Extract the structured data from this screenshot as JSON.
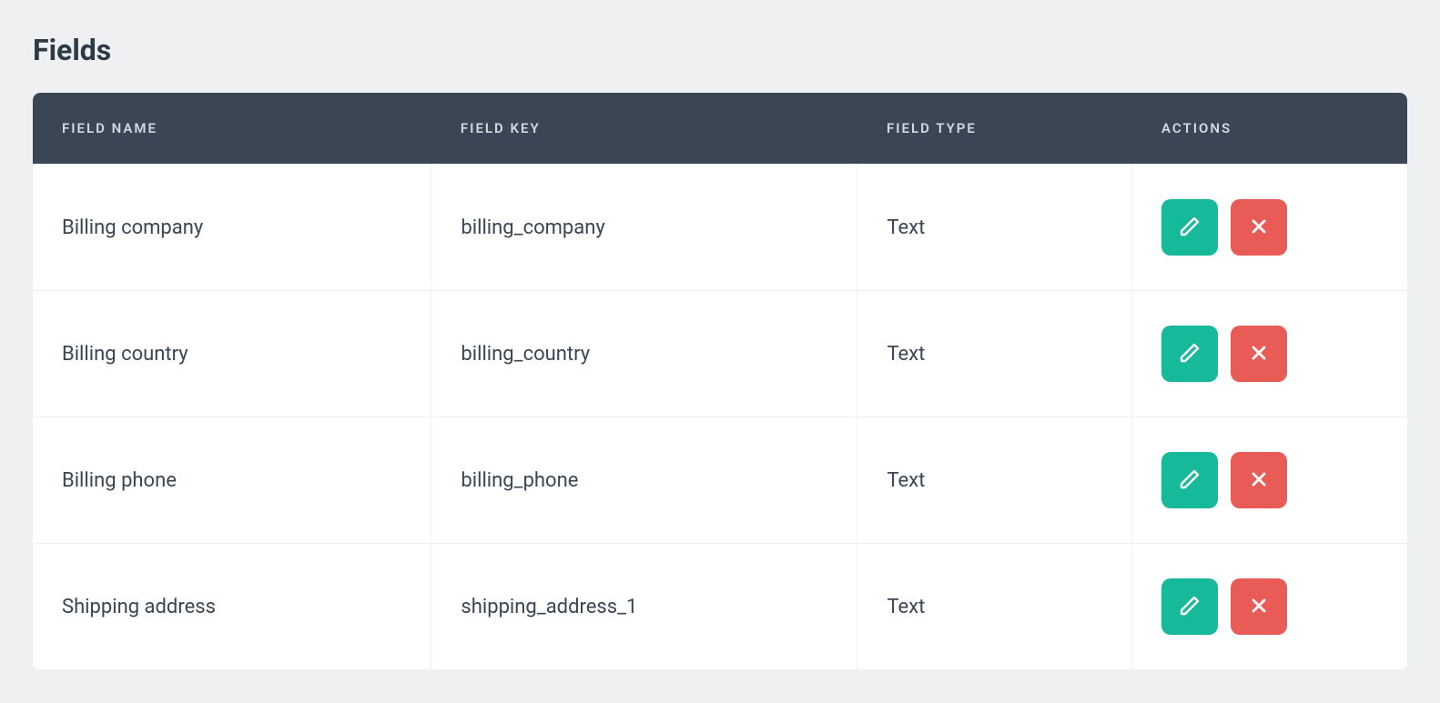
{
  "title": "Fields",
  "columns": {
    "name": "FIELD NAME",
    "key": "FIELD KEY",
    "type": "FIELD TYPE",
    "actions": "ACTIONS"
  },
  "rows": [
    {
      "name": "Billing company",
      "key": "billing_company",
      "type": "Text"
    },
    {
      "name": "Billing country",
      "key": "billing_country",
      "type": "Text"
    },
    {
      "name": "Billing phone",
      "key": "billing_phone",
      "type": "Text"
    },
    {
      "name": "Shipping address",
      "key": "shipping_address_1",
      "type": "Text"
    }
  ],
  "icons": {
    "edit": "pencil-icon",
    "delete": "close-icon"
  },
  "colors": {
    "header_bg": "#3a4653",
    "page_bg": "#eef0f2",
    "edit_bg": "#16b99a",
    "delete_bg": "#e95b56"
  }
}
